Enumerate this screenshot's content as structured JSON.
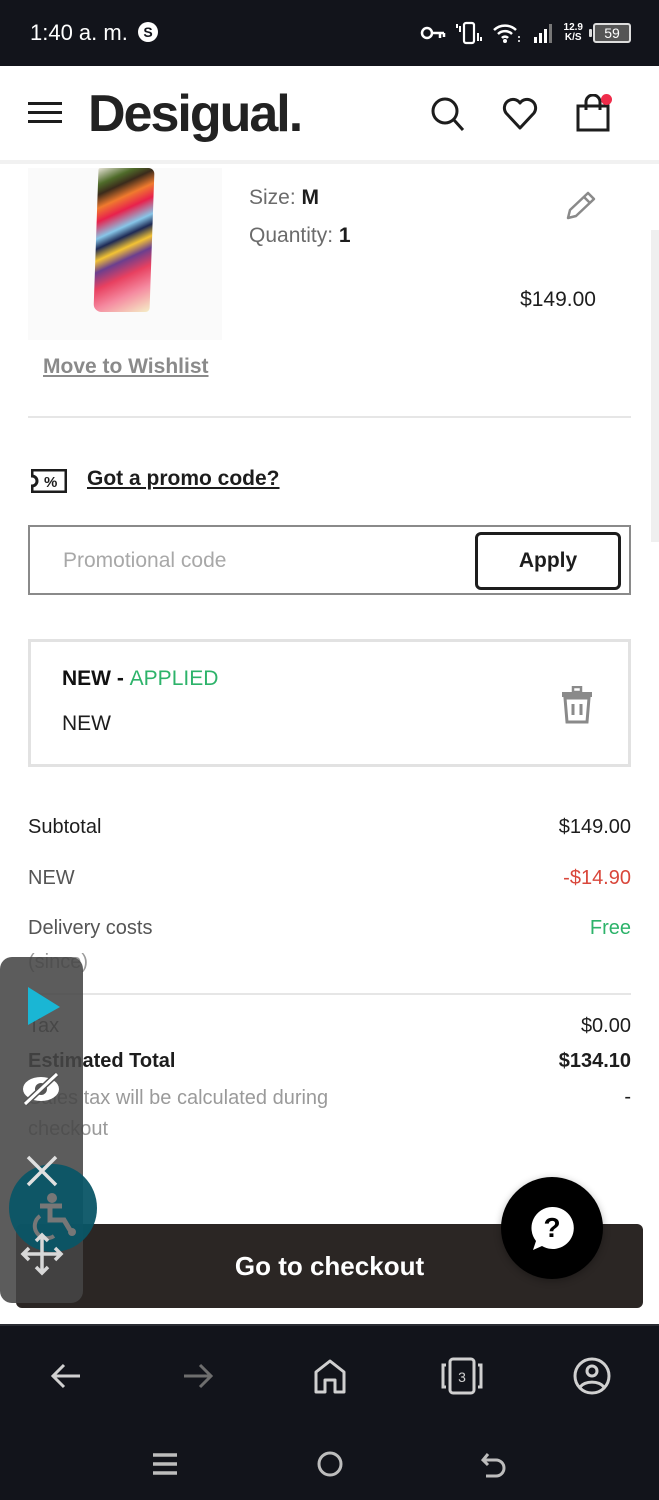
{
  "status_bar": {
    "time": "1:40 a. m.",
    "notification_badge": "S",
    "net_speed_value": "12.9",
    "net_speed_unit": "K/S",
    "battery": "59",
    "icons": [
      "vpn-key-icon",
      "vibrate-icon",
      "wifi-icon",
      "signal-icon",
      "battery-icon"
    ]
  },
  "header": {
    "brand": "Desigual.",
    "icons": [
      "menu-icon",
      "search-icon",
      "heart-icon",
      "bag-icon"
    ],
    "bag_has_items": true,
    "accent_color": "#ef2c4a"
  },
  "product": {
    "size_label": "Size:",
    "size_value": "M",
    "quantity_label": "Quantity:",
    "quantity_value": "1",
    "price": "$149.00",
    "move_to_wishlist": "Move to Wishlist"
  },
  "promo": {
    "link_label": "Got a promo code?",
    "icon_text": "%",
    "input_placeholder": "Promotional code",
    "input_value": "",
    "apply_label": "Apply"
  },
  "applied_code": {
    "code": "NEW",
    "separator": " - ",
    "status": "APPLIED",
    "description": "NEW",
    "status_color": "#2db36a"
  },
  "summary": {
    "subtotal_label": "Subtotal",
    "subtotal_value": "$149.00",
    "discount_label": "NEW",
    "discount_value": "-$14.90",
    "delivery_label": "Delivery costs",
    "delivery_value": "Free",
    "delivery_note": "(since)",
    "tax_label": "Tax",
    "tax_value": "$0.00",
    "total_label": "Estimated Total",
    "total_value": "$134.10",
    "tax_note": "Sales tax will be calculated during checkout",
    "tax_note_value": "-",
    "discount_color": "#d9473b"
  },
  "checkout": {
    "button_label": "Go to checkout",
    "help_label": "?"
  },
  "browser_bar": {
    "tab_count": "3",
    "icons": [
      "back-arrow-icon",
      "forward-arrow-icon",
      "home-icon",
      "tabs-icon",
      "profile-icon"
    ]
  },
  "accessibility_overlay": {
    "icons": [
      "play-icon",
      "hide-eye-icon",
      "close-icon",
      "wheelchair-icon",
      "move-icon"
    ]
  },
  "system_nav": {
    "icons": [
      "recent-apps-icon",
      "home-circle-icon",
      "back-icon"
    ]
  }
}
